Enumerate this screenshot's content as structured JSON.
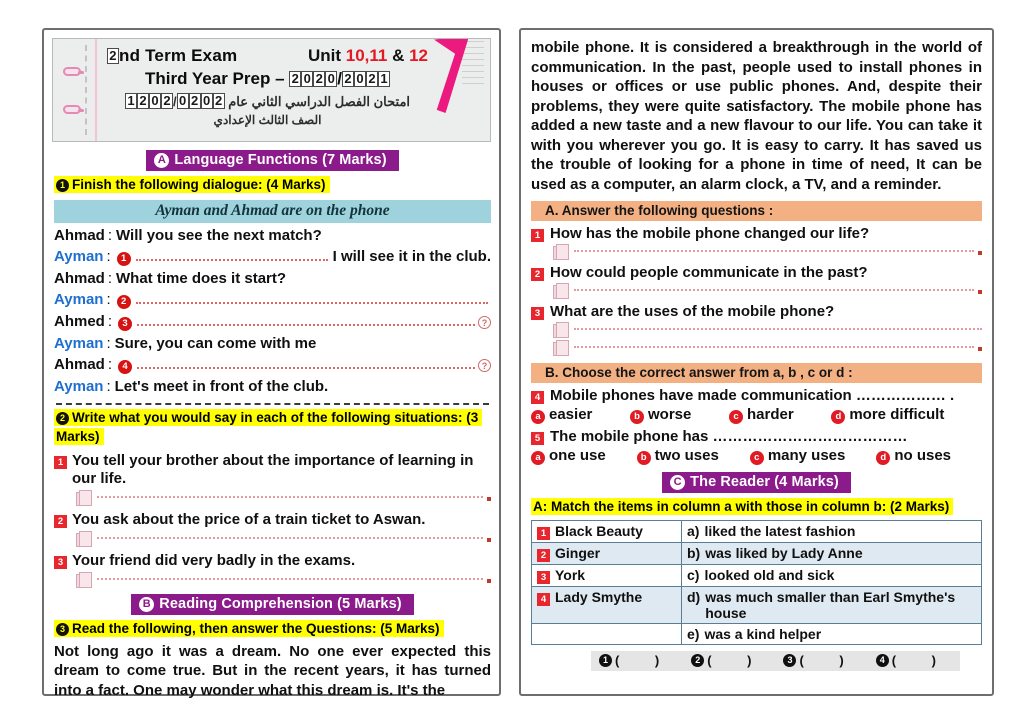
{
  "header": {
    "exam_number_box": "2",
    "title_rest": "nd Term Exam",
    "unit_label": "Unit ",
    "unit_numbers": "10,11",
    "unit_and": " & ",
    "unit_last": "12",
    "line2_prefix": "Third Year Prep – ",
    "year_a": "2020",
    "year_slash": "/",
    "year_b": "2021",
    "arabic_line1_right": "امتحان الفصل الدراسي الثاني عام",
    "arabic_year_a": "2020",
    "arabic_slash": "/",
    "arabic_year_b": "2021",
    "arabic_line2": "الصف الثالث الإعدادي"
  },
  "section_a": {
    "banner_letter": "A",
    "banner_title": "Language Functions (7 Marks)",
    "q1_number": "1",
    "q1_title": "Finish the following dialogue: (4 Marks)",
    "dialogue_caption": "Ayman and Ahmad are on the phone",
    "dialogue": [
      {
        "speaker": "Ahmad",
        "color": "ahmad",
        "blank": null,
        "text": "Will you see the next match?",
        "trailing": null,
        "qmark": false
      },
      {
        "speaker": "Ayman",
        "color": "ayman",
        "blank": "1",
        "text": "",
        "trailing": "I will see it in the club.",
        "qmark": false
      },
      {
        "speaker": "Ahmad",
        "color": "ahmad",
        "blank": null,
        "text": "What time does it start?",
        "trailing": null,
        "qmark": false
      },
      {
        "speaker": "Ayman",
        "color": "ayman",
        "blank": "2",
        "text": "",
        "trailing": null,
        "qmark": false
      },
      {
        "speaker": "Ahmed",
        "color": "ahmad",
        "blank": "3",
        "text": "",
        "trailing": null,
        "qmark": true
      },
      {
        "speaker": "Ayman",
        "color": "ayman",
        "blank": null,
        "text": "Sure, you can come with me",
        "trailing": null,
        "qmark": false
      },
      {
        "speaker": "Ahmad",
        "color": "ahmad",
        "blank": "4",
        "text": "",
        "trailing": null,
        "qmark": true
      },
      {
        "speaker": "Ayman",
        "color": "ayman",
        "blank": null,
        "text": "Let's meet in front of the club.",
        "trailing": null,
        "qmark": false
      }
    ],
    "q2_number": "2",
    "q2_title": "Write what you would say in each of the following situations: (3 Marks)",
    "situations": [
      {
        "num": "1",
        "text": "You tell your brother about the importance of learning in our life."
      },
      {
        "num": "2",
        "text": "You ask about the price of a train ticket to Aswan."
      },
      {
        "num": "3",
        "text": "Your friend did very badly in the exams."
      }
    ]
  },
  "section_b": {
    "banner_letter": "B",
    "banner_title": "Reading Comprehension (5 Marks)",
    "q3_number": "3",
    "q3_title": "Read the following, then answer the Questions: (5 Marks)",
    "passage_left": "Not long ago it was a dream. No one ever expected this dream to come true. But in the recent years, it has turned into a fact. One may wonder what this dream is. It's the",
    "passage_right": "mobile phone. It is considered a breakthrough in the world of communication. In the past, people used to install phones in houses or offices or use public phones. And, despite their problems, they were quite satisfactory. The mobile phone has added a new taste and a new flavour to our life. You can take it with you wherever you go. It is easy to carry. It has saved us the trouble of looking for a phone in time of need, It can be used as a computer, an alarm clock, a TV, and a reminder.",
    "part_a_title": "A. Answer the following questions :",
    "questions": [
      {
        "num": "1",
        "text": "How has the mobile phone changed our life?",
        "lines": 1
      },
      {
        "num": "2",
        "text": "How could people communicate in the past?",
        "lines": 1
      },
      {
        "num": "3",
        "text": "What are the uses of the mobile phone?",
        "lines": 2
      }
    ],
    "part_b_title": "B. Choose the correct answer from a, b , c or d :",
    "mcqs": [
      {
        "num": "4",
        "stem": "Mobile phones have made communication ……………… .",
        "options": [
          {
            "letter": "a",
            "text": "easier"
          },
          {
            "letter": "b",
            "text": "worse"
          },
          {
            "letter": "c",
            "text": "harder"
          },
          {
            "letter": "d",
            "text": "more difficult"
          }
        ]
      },
      {
        "num": "5",
        "stem": "The mobile phone has …………………………………",
        "options": [
          {
            "letter": "a",
            "text": "one use"
          },
          {
            "letter": "b",
            "text": "two uses"
          },
          {
            "letter": "c",
            "text": "many uses"
          },
          {
            "letter": "d",
            "text": "no uses"
          }
        ]
      }
    ]
  },
  "section_c": {
    "banner_letter": "C",
    "banner_title": "The Reader (4 Marks)",
    "match_title": "A: Match the items in column a with those in column b: (2 Marks)",
    "rows": [
      {
        "num": "1",
        "a": "Black Beauty",
        "b_label": "a)",
        "b_text": "liked the latest fashion"
      },
      {
        "num": "2",
        "a": "Ginger",
        "b_label": "b)",
        "b_text": " was liked by Lady Anne"
      },
      {
        "num": "3",
        "a": "York",
        "b_label": "c)",
        "b_text": "looked old and sick"
      },
      {
        "num": "4",
        "a": "Lady Smythe",
        "b_label": "d)",
        "b_text": "was much smaller than Earl Smythe's house"
      },
      {
        "num": "",
        "a": "",
        "b_label": "e)",
        "b_text": "was a kind helper"
      }
    ],
    "answer_slots": [
      "1",
      "2",
      "3",
      "4"
    ]
  }
}
